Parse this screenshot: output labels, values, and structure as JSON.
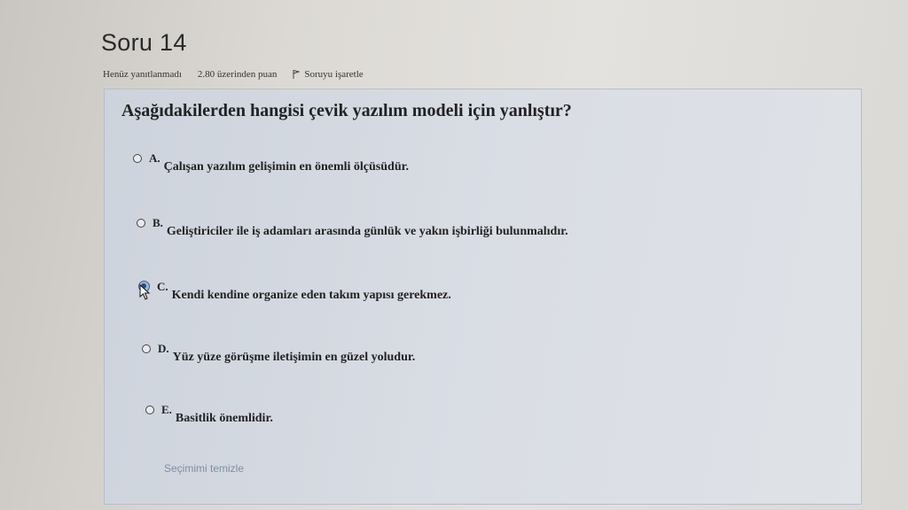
{
  "question_header": {
    "title": "Soru 14",
    "status": "Henüz yanıtlanmadı",
    "points": "2.80 üzerinden puan",
    "flag_label": "Soruyu işaretle"
  },
  "question": {
    "text": "Aşağıdakilerden hangisi çevik yazılım modeli için yanlıştır?",
    "selected_option": "C",
    "options": [
      {
        "letter": "A.",
        "text": "Çalışan yazılım gelişimin en önemli ölçüsüdür."
      },
      {
        "letter": "B.",
        "text": "Geliştiriciler ile iş adamları arasında günlük ve yakın işbirliği bulunmalıdır."
      },
      {
        "letter": "C.",
        "text": "Kendi kendine organize eden takım yapısı gerekmez."
      },
      {
        "letter": "D.",
        "text": "Yüz yüze görüşme iletişimin en güzel yoludur."
      },
      {
        "letter": "E.",
        "text": "Basitlik önemlidir."
      }
    ]
  },
  "clear_selection_label": "Seçimimi temizle",
  "colors": {
    "card_background": "#d9dde4",
    "selected_radio": "#2d4d78",
    "clear_link": "#7f8fa6"
  }
}
